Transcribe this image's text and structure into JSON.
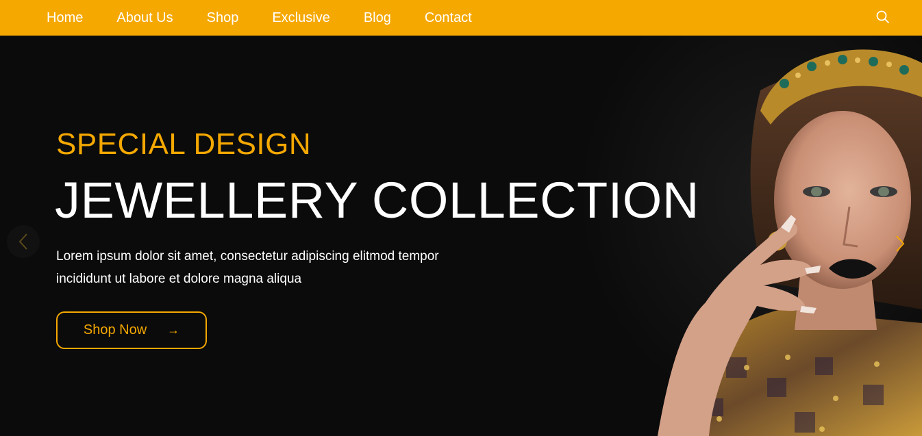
{
  "nav": {
    "items": [
      {
        "label": "Home"
      },
      {
        "label": "About Us"
      },
      {
        "label": "Shop"
      },
      {
        "label": "Exclusive"
      },
      {
        "label": "Blog"
      },
      {
        "label": "Contact"
      }
    ],
    "search_icon": "search-icon"
  },
  "hero": {
    "eyebrow": "SPECIAL DESIGN",
    "headline": "JEWELLERY COLLECTION",
    "description_line1": "Lorem ipsum dolor sit amet, consectetur adipiscing elitmod tempor",
    "description_line2": "incididunt ut labore et dolore magna aliqua",
    "cta_label": "Shop Now",
    "cta_arrow": "→"
  },
  "carousel": {
    "prev_icon": "chevron-left-icon",
    "next_icon": "chevron-right-icon"
  },
  "colors": {
    "accent": "#f5a800",
    "background": "#0b0b0b",
    "text": "#ffffff"
  }
}
